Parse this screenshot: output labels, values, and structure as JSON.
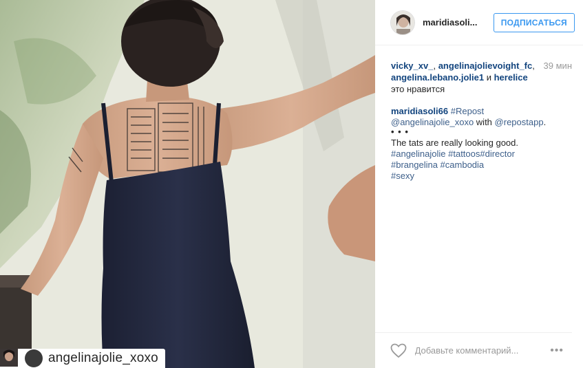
{
  "post": {
    "author": "maridiasoli...",
    "follow_label": "ПОДПИСАТЬСЯ",
    "photo_overlay_username": "angelinajolie_xoxo"
  },
  "likes": {
    "users": [
      "vicky_xv_",
      "angelinajolievoight_fc",
      "angelina.lebano.jolie1",
      "herelice"
    ],
    "separator": ",",
    "conjunction": "и",
    "suffix": "это нравится",
    "time_ago": "39 мин"
  },
  "caption": {
    "author": "maridiasoli66",
    "repost_tag": "#Repost",
    "mention_1": "@angelinajolie_xoxo",
    "with_text": "with",
    "mention_2": "@repostapp",
    "period": ".",
    "dots": "• • •",
    "text": "The tats are really looking good.",
    "tags_line_1": "#angelinajolie #tattoos#director",
    "tags_line_2": "#brangelina #cambodia",
    "tags_line_3": "#sexy"
  },
  "comment": {
    "placeholder": "Добавьте комментарий..."
  },
  "icons": {
    "repost": "repost-icon",
    "like": "heart-icon",
    "more": "more-options-icon"
  },
  "colors": {
    "follow_blue": "#3897f0",
    "link_blue": "#12447e",
    "tag_blue": "#3d5f8a"
  }
}
